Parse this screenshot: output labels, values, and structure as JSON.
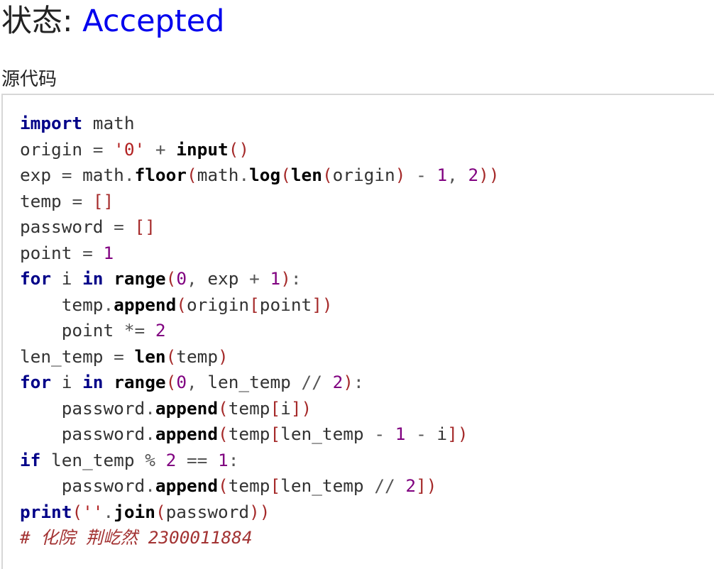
{
  "status": {
    "label": "状态: ",
    "value": "Accepted"
  },
  "source": {
    "heading": "源代码"
  },
  "code": {
    "language": "python",
    "comment": "# 化院 荆屹然 2300011884",
    "lines": [
      "import math",
      "origin = '0' + input()",
      "exp = math.floor(math.log(len(origin) - 1, 2))",
      "temp = []",
      "password = []",
      "point = 1",
      "for i in range(0, exp + 1):",
      "    temp.append(origin[point])",
      "    point *= 2",
      "len_temp = len(temp)",
      "for i in range(0, len_temp // 2):",
      "    password.append(temp[i])",
      "    password.append(temp[len_temp - 1 - i])",
      "if len_temp % 2 == 1:",
      "    password.append(temp[len_temp // 2])",
      "print(''.join(password))",
      "# 化院 荆屹然 2300011884"
    ]
  },
  "colors": {
    "accepted": "#0000ee",
    "keyword": "#000088",
    "number": "#800080",
    "string": "#b22222",
    "comment": "#a33333",
    "border": "#d7d7d7"
  }
}
